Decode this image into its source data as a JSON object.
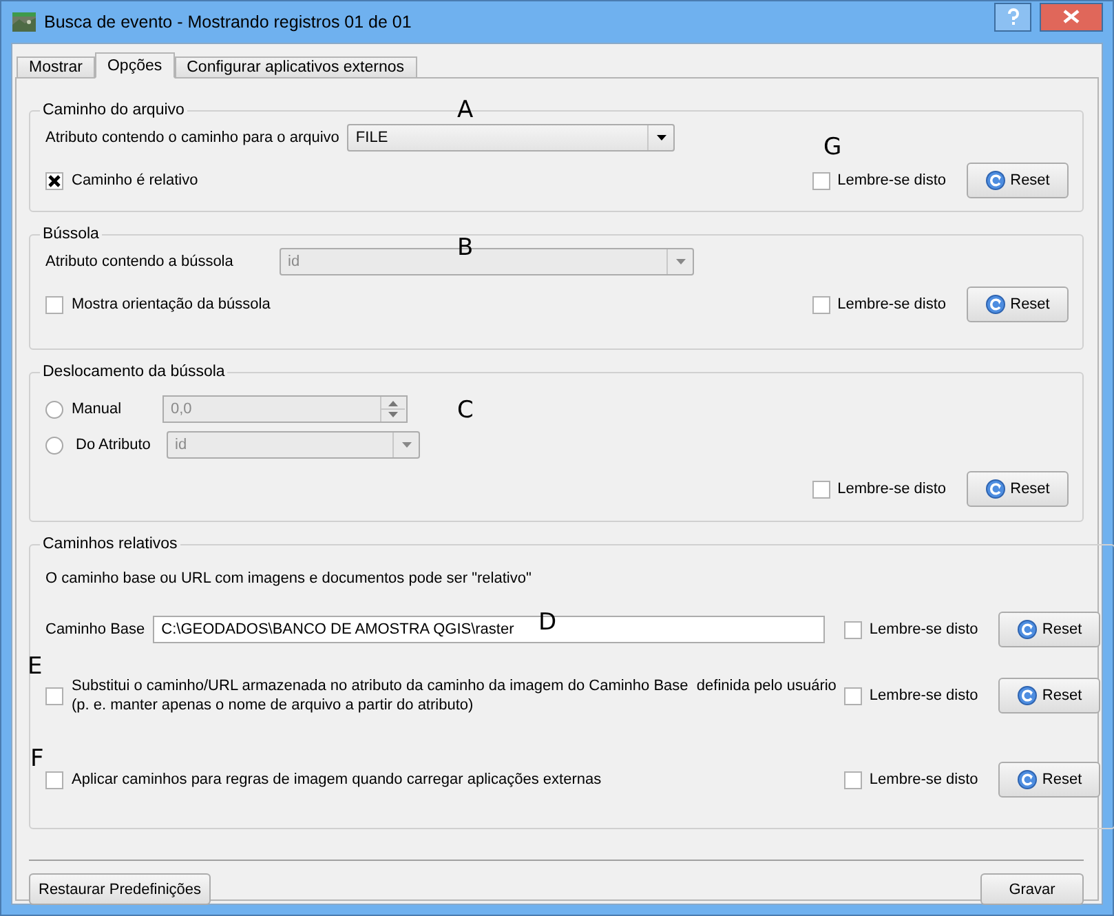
{
  "window": {
    "title": "Busca de evento  - Mostrando registros 01 de 01"
  },
  "tabs": [
    {
      "label": "Mostrar",
      "selected": false
    },
    {
      "label": "Opções",
      "selected": true
    },
    {
      "label": "Configurar aplicativos externos",
      "selected": false
    }
  ],
  "groups": [
    {
      "title": "Caminho do arquivo",
      "rows": [
        {
          "kind": "combo",
          "label": "Atributo contendo o caminho para o arquivo",
          "value": "FILE",
          "disabled": false
        },
        {
          "kind": "checkbox",
          "label": "Caminho é relativo",
          "checked": true,
          "remember": {
            "label": "Lembre-se disto",
            "checked": false
          },
          "reset": "Reset"
        }
      ]
    },
    {
      "title": "Bússola",
      "rows": [
        {
          "kind": "combo",
          "label": "Atributo contendo a bússola",
          "value": "id",
          "disabled": true
        },
        {
          "kind": "checkbox",
          "label": "Mostra orientação da bússola",
          "checked": false,
          "remember": {
            "label": "Lembre-se disto",
            "checked": false
          },
          "reset": "Reset"
        }
      ]
    },
    {
      "title": "Deslocamento da bússola",
      "rows": [
        {
          "kind": "radio_spin",
          "label": "Manual",
          "selected": false,
          "value": "0,0",
          "disabled": true
        },
        {
          "kind": "radio_combo",
          "label": "Do Atributo",
          "selected": false,
          "value": "id",
          "disabled": true
        },
        {
          "kind": "actions",
          "remember": {
            "label": "Lembre-se disto",
            "checked": false
          },
          "reset": "Reset"
        }
      ]
    },
    {
      "title": "Caminhos relativos",
      "rows": [
        {
          "kind": "note",
          "text": "O caminho base ou URL com imagens e documentos pode ser \"relativo\""
        },
        {
          "kind": "path",
          "label": "Caminho Base",
          "value": "C:\\GEODADOS\\BANCO DE AMOSTRA QGIS\\raster",
          "remember": {
            "label": "Lembre-se disto",
            "checked": false
          },
          "reset": "Reset"
        },
        {
          "kind": "checkbox",
          "label": "Substitui o caminho/URL armazenada no atributo da caminho da imagem do Caminho Base  definida pelo usuário\n(p. e. manter apenas o nome de arquivo a partir do atributo)",
          "checked": false,
          "remember": {
            "label": "Lembre-se disto",
            "checked": false
          },
          "reset": "Reset"
        },
        {
          "kind": "checkbox",
          "label": "Aplicar caminhos para regras de imagem quando carregar aplicações externas",
          "checked": false,
          "remember": {
            "label": "Lembre-se disto",
            "checked": false
          },
          "reset": "Reset"
        }
      ]
    }
  ],
  "annotations": [
    "A",
    "B",
    "C",
    "D",
    "E",
    "F",
    "G"
  ],
  "buttons": {
    "left": "Restaurar Predefinições",
    "right": "Gravar"
  }
}
